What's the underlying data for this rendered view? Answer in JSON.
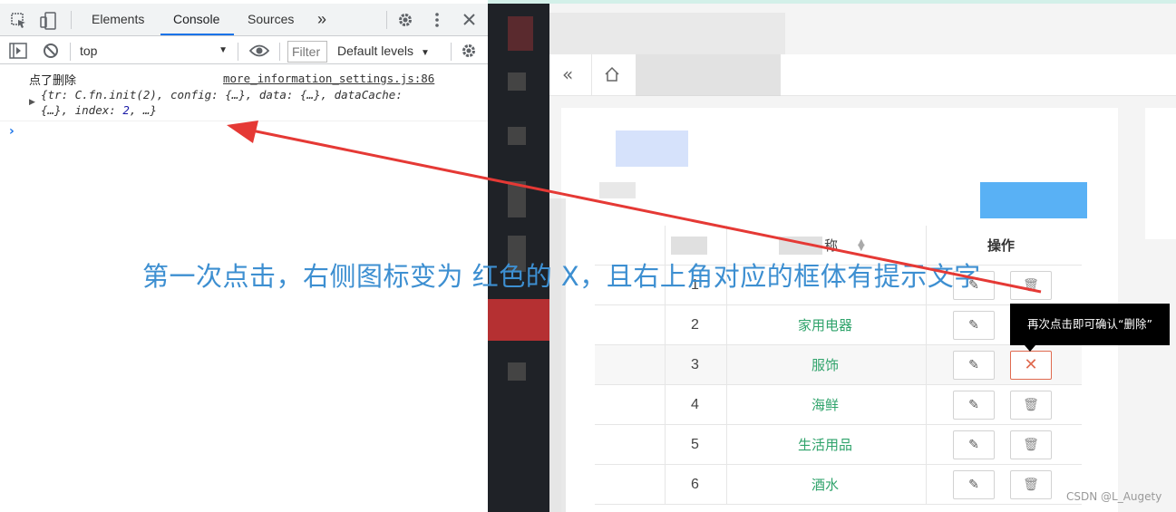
{
  "devtools": {
    "tabs": [
      {
        "label": "Elements"
      },
      {
        "label": "Console",
        "active": true
      },
      {
        "label": "Sources"
      }
    ],
    "more_tabs": "»",
    "toolbar": {
      "context": "top",
      "filter_placeholder": "Filter",
      "levels": "Default levels"
    },
    "console": {
      "message": "点了删除",
      "source": "more_information_settings.js:86",
      "object_line1": "{tr: C.fn.init(2), config: {…}, data: {…}, dataCache:",
      "object_line2_pre": "{…}, index: ",
      "object_index": "2",
      "object_line2_post": ", …}",
      "prompt": "›"
    }
  },
  "app": {
    "table": {
      "header_name": "称",
      "header_actions": "操作",
      "rows": [
        {
          "index": "1",
          "name": ""
        },
        {
          "index": "2",
          "name": "家用电器"
        },
        {
          "index": "3",
          "name": "服饰"
        },
        {
          "index": "4",
          "name": "海鲜"
        },
        {
          "index": "5",
          "name": "生活用品"
        },
        {
          "index": "6",
          "name": "酒水"
        }
      ]
    },
    "tooltip": "再次点击即可确认“删除”"
  },
  "annotation": "第一次点击，右侧图标变为 红色的 X，且右上角对应的框体有提示文字",
  "watermark": "CSDN @L_Augety",
  "colors": {
    "accent_blue": "#1a73e8",
    "name_green": "#2fa36b",
    "danger_red": "#e06a4f",
    "annotation_blue": "#3d8fd1",
    "arrow_red": "#e53935"
  }
}
